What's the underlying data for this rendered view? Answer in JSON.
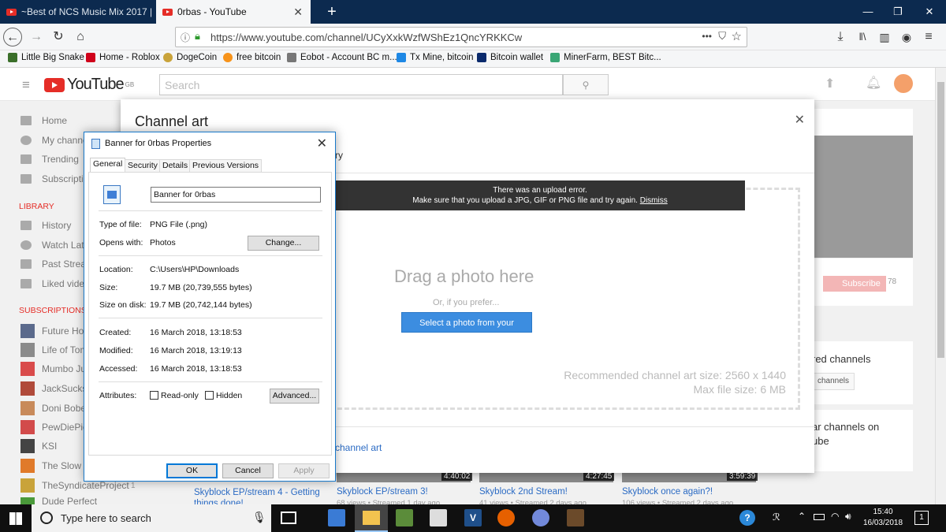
{
  "browser": {
    "tabs": [
      {
        "title": "~Best of NCS Music Mix 2017 |"
      },
      {
        "title": "0rbas - YouTube"
      }
    ],
    "url": "https://www.youtube.com/channel/UCyXxkWzfWShEz1QncYRKKCw",
    "url_menu": "•••",
    "bookmarks": [
      {
        "label": "Little Big Snake",
        "color": "#3b6f2a"
      },
      {
        "label": "Home - Roblox",
        "color": "#d0021b"
      },
      {
        "label": "DogeCoin",
        "color": "#c9a33a"
      },
      {
        "label": "free bitcoin",
        "color": "#f7931a"
      },
      {
        "label": "Eobot - Account BC m...",
        "color": "#777777"
      },
      {
        "label": "Tx Mine, bitcoin",
        "color": "#1e88e5"
      },
      {
        "label": "Bitcoin wallet",
        "color": "#0a2a6c"
      },
      {
        "label": "MinerFarm, BEST Bitc...",
        "color": "#3aa675"
      }
    ]
  },
  "youtube": {
    "logo": "YouTube",
    "region": "GB",
    "search_placeholder": "Search",
    "sidebar": {
      "main": [
        "Home",
        "My channel",
        "Trending",
        "Subscriptions"
      ],
      "library_heading": "LIBRARY",
      "library": [
        "History",
        "Watch Later",
        "Past Streams",
        "Liked videos"
      ],
      "subs_heading": "SUBSCRIPTIONS",
      "subs": [
        {
          "name": "Future House",
          "color": "#5b6a8c"
        },
        {
          "name": "Life of Tom",
          "color": "#8b8b8b"
        },
        {
          "name": "Mumbo Jumbo",
          "color": "#d94b4b"
        },
        {
          "name": "JackSucks",
          "color": "#b04a3a"
        },
        {
          "name": "Doni Bobes",
          "color": "#c88a5a"
        },
        {
          "name": "PewDiePie",
          "color": "#d24b4b"
        },
        {
          "name": "KSI",
          "color": "#444444"
        },
        {
          "name": "The Slow Mo Guys",
          "color": "#e07a2a"
        },
        {
          "name": "TheSyndicateProject",
          "color": "#c9a33a"
        },
        {
          "name": "Dude Perfect",
          "color": "#4a9a3a"
        }
      ],
      "sub_counts": [
        "1",
        "1"
      ]
    },
    "right": {
      "subscribe": "Subscribe",
      "sub_count": "78",
      "featured": "red channels",
      "channels_btn": "channels",
      "related_line1": "ar channels on",
      "related_line2": "ube"
    },
    "videos": [
      {
        "title": "Skyblock EP/stream 4 - Getting things done!",
        "meta": "",
        "duration": "4:40:02"
      },
      {
        "title": "Skyblock EP/stream 3!",
        "meta": "68 views • Streamed 1 day ago",
        "duration": "4:27:45"
      },
      {
        "title": "Skyblock 2nd Stream!",
        "meta": "41 views • Streamed 2 days ago",
        "duration": "3:59:39"
      },
      {
        "title": "Skyblock once again?!",
        "meta": "106 views • Streamed 2 days ago",
        "duration": ""
      }
    ]
  },
  "modal": {
    "title": "Channel art",
    "tab_tail": "ry",
    "error_line1": "There was an upload error.",
    "error_line2": "Make sure that you upload a JPG, GIF or PNG file and try again.",
    "dismiss": "Dismiss",
    "drag": "Drag a photo here",
    "or": "Or, if you prefer...",
    "select_button": "Select a photo from your computer",
    "rec_size": "Recommended channel art size: 2560 x 1440",
    "max_size": "Max file size: 6 MB",
    "link": "channel art"
  },
  "dialog": {
    "title": "Banner for 0rbas Properties",
    "tabs": [
      "General",
      "Security",
      "Details",
      "Previous Versions"
    ],
    "filename": "Banner for 0rbas",
    "labels": {
      "type": "Type of file:",
      "opens": "Opens with:",
      "location": "Location:",
      "size": "Size:",
      "size_on_disk": "Size on disk:",
      "created": "Created:",
      "modified": "Modified:",
      "accessed": "Accessed:",
      "attributes": "Attributes:"
    },
    "values": {
      "type": "PNG File (.png)",
      "opens": "Photos",
      "location": "C:\\Users\\HP\\Downloads",
      "size": "19.7 MB (20,739,555 bytes)",
      "size_on_disk": "19.7 MB (20,742,144 bytes)",
      "created": "16 March 2018, 13:18:53",
      "modified": "16 March 2018, 13:19:13",
      "accessed": "16 March 2018, 13:18:53"
    },
    "change_btn": "Change...",
    "readonly": "Read-only",
    "hidden": "Hidden",
    "advanced_btn": "Advanced...",
    "ok": "OK",
    "cancel": "Cancel",
    "apply": "Apply"
  },
  "taskbar": {
    "search_placeholder": "Type here to search",
    "time": "15:40",
    "date": "16/03/2018",
    "notif_count": "1"
  }
}
